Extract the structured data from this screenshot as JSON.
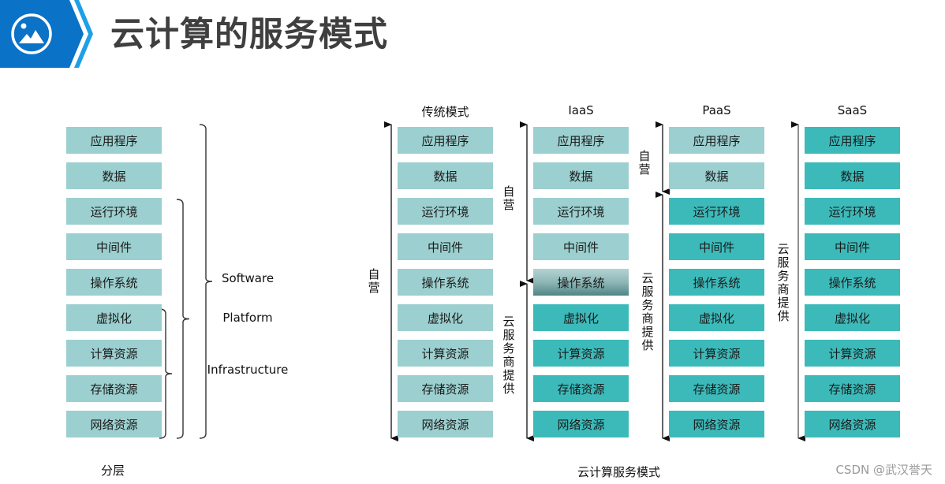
{
  "header": {
    "title": "云计算的服务模式",
    "icon": "image-icon",
    "brand_color": "#0a72c7",
    "accent_color": "#1ea0e6"
  },
  "colors": {
    "self_managed": "#9ccfcf",
    "provider_managed": "#3cbaba",
    "transition": "#8fb6b6"
  },
  "layers": {
    "items": [
      "应用程序",
      "数据",
      "运行环境",
      "中间件",
      "操作系统",
      "虚拟化",
      "计算资源",
      "存储资源",
      "网络资源"
    ],
    "groups": [
      {
        "label": "Software",
        "from": "应用程序",
        "to": "网络资源"
      },
      {
        "label": "Platform",
        "from": "运行环境",
        "to": "网络资源"
      },
      {
        "label": "Infrastructure",
        "from": "虚拟化",
        "to": "网络资源"
      }
    ],
    "caption": "分层"
  },
  "models": {
    "caption": "云计算服务模式",
    "columns": [
      {
        "title": "传统模式",
        "items": [
          "应用程序",
          "数据",
          "运行环境",
          "中间件",
          "操作系统",
          "虚拟化",
          "计算资源",
          "存储资源",
          "网络资源"
        ],
        "styles": [
          "light",
          "light",
          "light",
          "light",
          "light",
          "light",
          "light",
          "light",
          "light"
        ],
        "self_label": "自营",
        "provider_label": ""
      },
      {
        "title": "IaaS",
        "items": [
          "应用程序",
          "数据",
          "运行环境",
          "中间件",
          "操作系统",
          "虚拟化",
          "计算资源",
          "存储资源",
          "网络资源"
        ],
        "styles": [
          "light",
          "light",
          "light",
          "light",
          "grad",
          "dark",
          "dark",
          "dark",
          "dark"
        ],
        "self_label": "自营",
        "provider_label": "云服务商提供"
      },
      {
        "title": "PaaS",
        "items": [
          "应用程序",
          "数据",
          "运行环境",
          "中间件",
          "操作系统",
          "虚拟化",
          "计算资源",
          "存储资源",
          "网络资源"
        ],
        "styles": [
          "light",
          "light",
          "dark",
          "dark",
          "dark",
          "dark",
          "dark",
          "dark",
          "dark"
        ],
        "self_label": "自营",
        "provider_label": "云服务商提供"
      },
      {
        "title": "SaaS",
        "items": [
          "应用程序",
          "数据",
          "运行环境",
          "中间件",
          "操作系统",
          "虚拟化",
          "计算资源",
          "存储资源",
          "网络资源"
        ],
        "styles": [
          "dark",
          "dark",
          "dark",
          "dark",
          "dark",
          "dark",
          "dark",
          "dark",
          "dark"
        ],
        "self_label": "",
        "provider_label": "云服务商提供"
      }
    ]
  },
  "watermark": "CSDN @武汉誉天"
}
